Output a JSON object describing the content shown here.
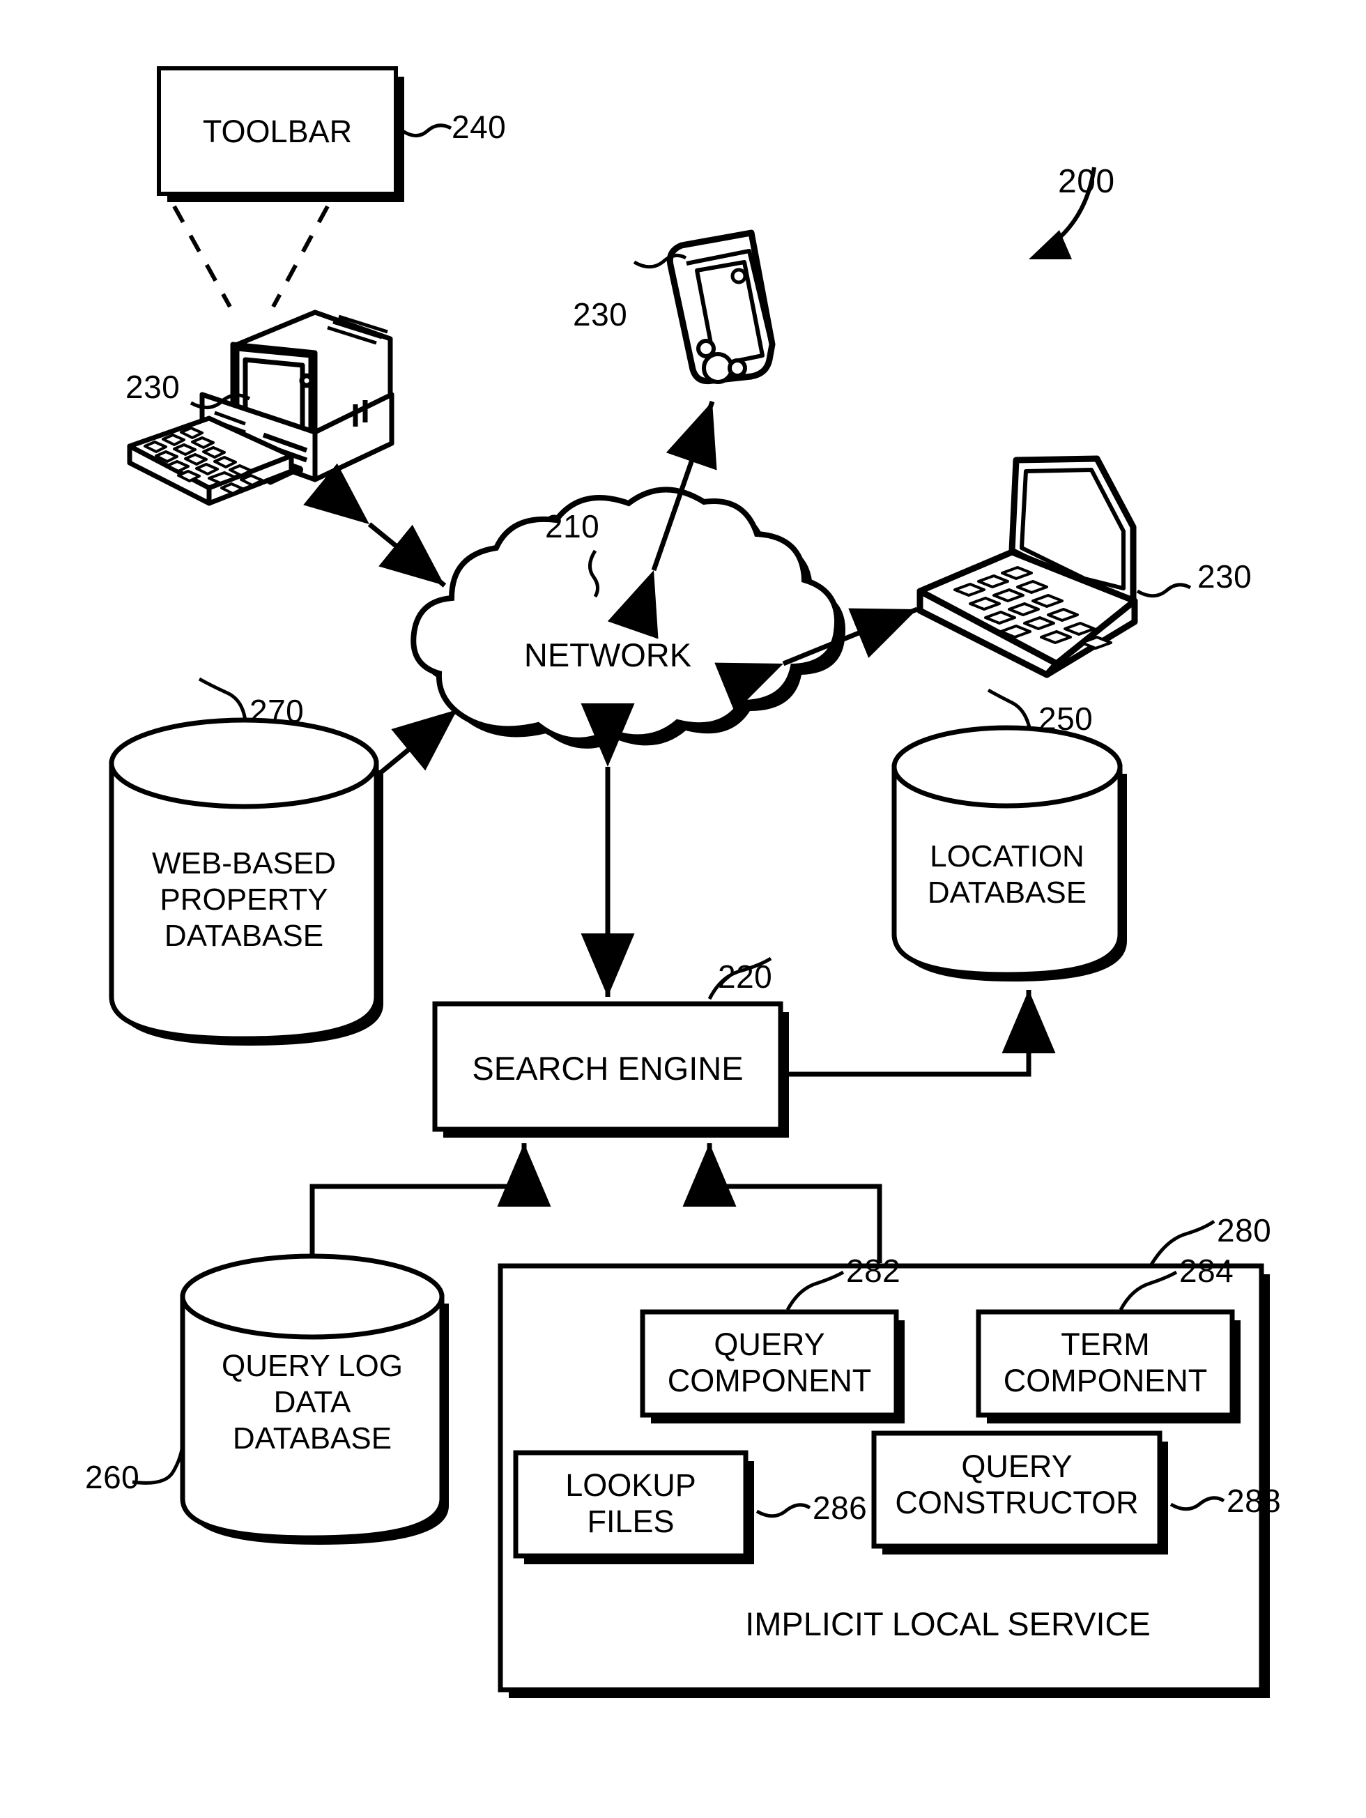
{
  "figure": {
    "overall_ref": "200",
    "nodes": {
      "toolbar": {
        "label": "TOOLBAR",
        "ref": "240"
      },
      "network": {
        "label": "NETWORK",
        "ref": "210"
      },
      "desktop_client": {
        "ref": "230",
        "icon": "desktop-computer-icon"
      },
      "handheld_client": {
        "ref": "230",
        "icon": "pda-handheld-icon"
      },
      "laptop_client": {
        "ref": "230",
        "icon": "laptop-icon"
      },
      "web_property_db": {
        "label": "WEB-BASED\nPROPERTY\nDATABASE",
        "line1": "WEB-BASED",
        "line2": "PROPERTY",
        "line3": "DATABASE",
        "ref": "270"
      },
      "location_db": {
        "label": "LOCATION\nDATABASE",
        "line1": "LOCATION",
        "line2": "DATABASE",
        "ref": "250"
      },
      "search_engine": {
        "label": "SEARCH ENGINE",
        "ref": "220"
      },
      "query_log_db": {
        "line1": "QUERY LOG",
        "line2": "DATA",
        "line3": "DATABASE",
        "ref": "260"
      },
      "implicit_local_service": {
        "label": "IMPLICIT LOCAL SERVICE",
        "ref": "280"
      },
      "query_component": {
        "line1": "QUERY",
        "line2": "COMPONENT",
        "ref": "282"
      },
      "term_component": {
        "line1": "TERM",
        "line2": "COMPONENT",
        "ref": "284"
      },
      "lookup_files": {
        "line1": "LOOKUP",
        "line2": "FILES",
        "ref": "286"
      },
      "query_constructor": {
        "line1": "QUERY",
        "line2": "CONSTRUCTOR",
        "ref": "288"
      }
    },
    "colors": {
      "ink": "#000000",
      "paper": "#ffffff"
    }
  }
}
